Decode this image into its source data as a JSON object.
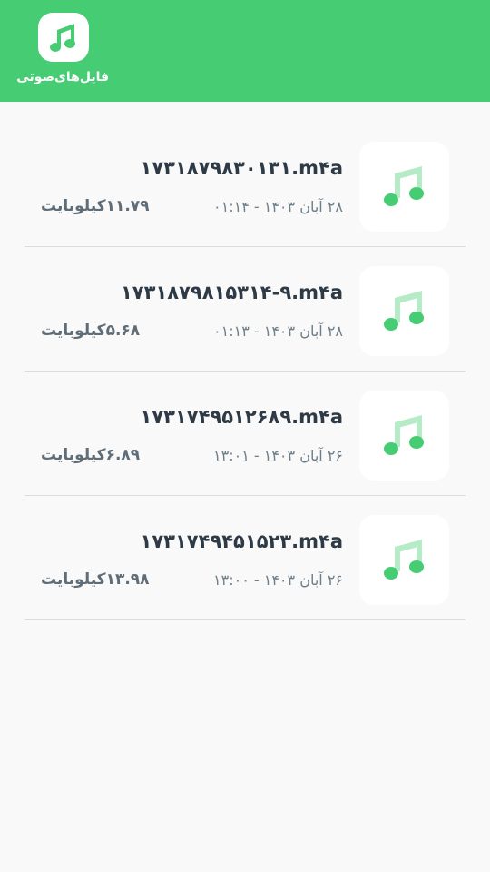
{
  "header": {
    "label": "فایل‌های‌صوتی",
    "icon": "music-note-icon",
    "color": "#46cd73"
  },
  "files": [
    {
      "name": "۱۷۳۱۸۷۹۸۳۰۱۳۱.m۴a",
      "date": "۲۸ آبان ۱۴۰۳ - ۰۱:۱۴",
      "size": "۱۱.۷۹کیلوبایت"
    },
    {
      "name": "۱۷۳۱۸۷۹۸۱۵۳۱۴-۹.m۴a",
      "date": "۲۸ آبان ۱۴۰۳ - ۰۱:۱۳",
      "size": "۵.۶۸کیلوبایت"
    },
    {
      "name": "۱۷۳۱۷۴۹۵۱۲۶۸۹.m۴a",
      "date": "۲۶ آبان ۱۴۰۳ - ۱۳:۰۱",
      "size": "۶.۸۹کیلوبایت"
    },
    {
      "name": "۱۷۳۱۷۴۹۴۵۱۵۲۳.m۴a",
      "date": "۲۶ آبان ۱۴۰۳ - ۱۳:۰۰",
      "size": "۱۳.۹۸کیلوبایت"
    }
  ]
}
